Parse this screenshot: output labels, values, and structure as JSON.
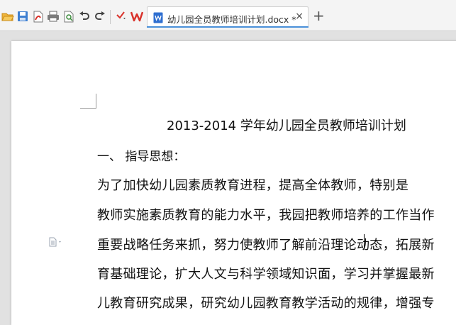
{
  "tab": {
    "title": "幼儿园全员教师培训计划.docx *",
    "close": "×",
    "new_tab": "+"
  },
  "document": {
    "title": "2013-2014 学年幼儿园全员教师培训计划",
    "heading": "一、   指导思想：",
    "lines": [
      "    为了加快幼儿园素质教育进程，提高全体教师，特别是",
      "教师实施素质教育的能力水平，我园把教师培养的工作当作",
      "重要战略任务来抓，努力使教师了解前沿理论动态，拓展新",
      "育基础理论，扩大人文与科学领域知识面，学习并掌握最新",
      "儿教育研究成果，研究幼儿园教育教学活动的规律，增强专"
    ]
  },
  "colors": {
    "accent": "#4a90d9",
    "wps_red": "#d9322b",
    "page_bg": "#e1e1e1"
  }
}
